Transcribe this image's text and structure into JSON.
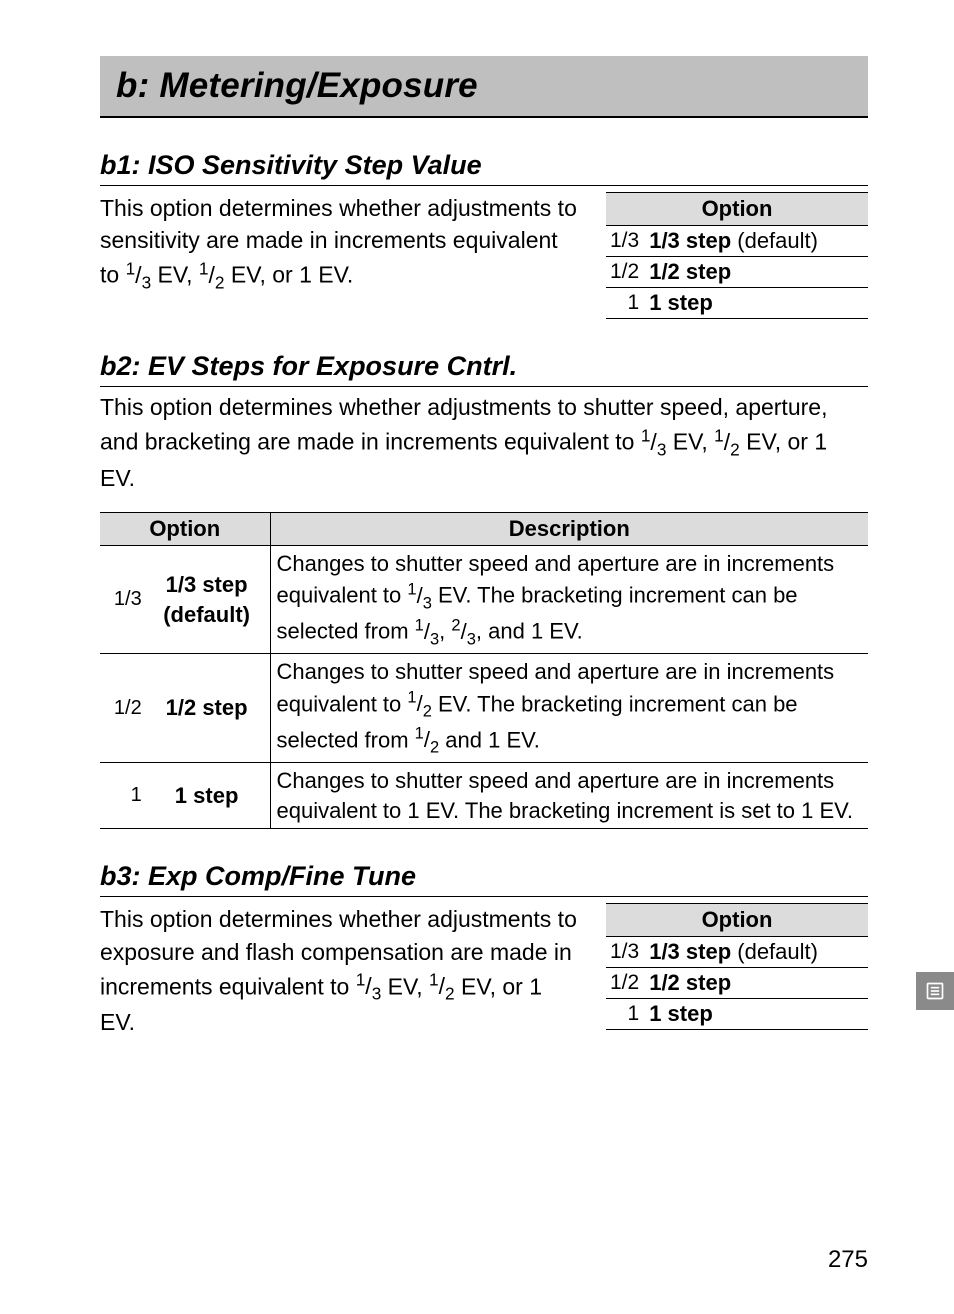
{
  "banner": "b: Metering/Exposure",
  "b1": {
    "heading": "b1: ISO Sensitivity Step Value",
    "body_html": "This option determines whether adjustments to sensitivity are made in increments equivalent to <span class='frac'><span class='sup'>1</span>/<span class='sub'>3</span></span> EV, <span class='frac'><span class='sup'>1</span>/<span class='sub'>2</span></span> EV, or 1&nbsp;EV.",
    "option_header": "Option",
    "rows": [
      {
        "icon": "1/3",
        "label": "<b>1/3 step</b> (default)"
      },
      {
        "icon": "1/2",
        "label": "<b>1/2 step</b>"
      },
      {
        "icon": "1",
        "label": "<b>1 step</b>"
      }
    ]
  },
  "b2": {
    "heading": "b2: EV Steps for Exposure Cntrl.",
    "body_html": "This option determines whether adjustments to shutter speed, aperture, and bracketing are made in increments equivalent to <span class='frac'><span class='sup'>1</span>/<span class='sub'>3</span></span>&nbsp;EV, <span class='frac'><span class='sup'>1</span>/<span class='sub'>2</span></span>&nbsp;EV, or 1 EV.",
    "headers": {
      "option": "Option",
      "desc": "Description"
    },
    "rows": [
      {
        "icon": "1/3",
        "name": "1/3 step<br>(default)",
        "desc": "Changes to shutter speed and aperture are in increments equivalent to <span class='frac'><span class='sup'>1</span>/<span class='sub'>3</span></span> EV.  The bracketing increment can be selected from <span class='frac'><span class='sup'>1</span>/<span class='sub'>3</span></span>, <span class='frac'><span class='sup'>2</span>/<span class='sub'>3</span></span>, and 1 EV."
      },
      {
        "icon": "1/2",
        "name": "1/2 step",
        "desc": "Changes to shutter speed and aperture are in increments equivalent to <span class='frac'><span class='sup'>1</span>/<span class='sub'>2</span></span> EV.  The bracketing increment can be selected from <span class='frac'><span class='sup'>1</span>/<span class='sub'>2</span></span> and 1 EV."
      },
      {
        "icon": "1",
        "name": "1 step",
        "desc": "Changes to shutter speed and aperture are in increments equivalent to 1 EV.  The bracketing increment is set to 1 EV."
      }
    ]
  },
  "b3": {
    "heading": "b3: Exp Comp/Fine Tune",
    "body_html": "This option determines whether adjustments to exposure and flash compensation are made in increments equivalent to <span class='frac'><span class='sup'>1</span>/<span class='sub'>3</span></span> EV, <span class='frac'><span class='sup'>1</span>/<span class='sub'>2</span></span> EV, or 1 EV.",
    "option_header": "Option",
    "rows": [
      {
        "icon": "1/3",
        "label": "<b>1/3 step</b> (default)"
      },
      {
        "icon": "1/2",
        "label": "<b>1/2 step</b>"
      },
      {
        "icon": "1",
        "label": "<b>1 step</b>"
      }
    ]
  },
  "page_number": "275"
}
